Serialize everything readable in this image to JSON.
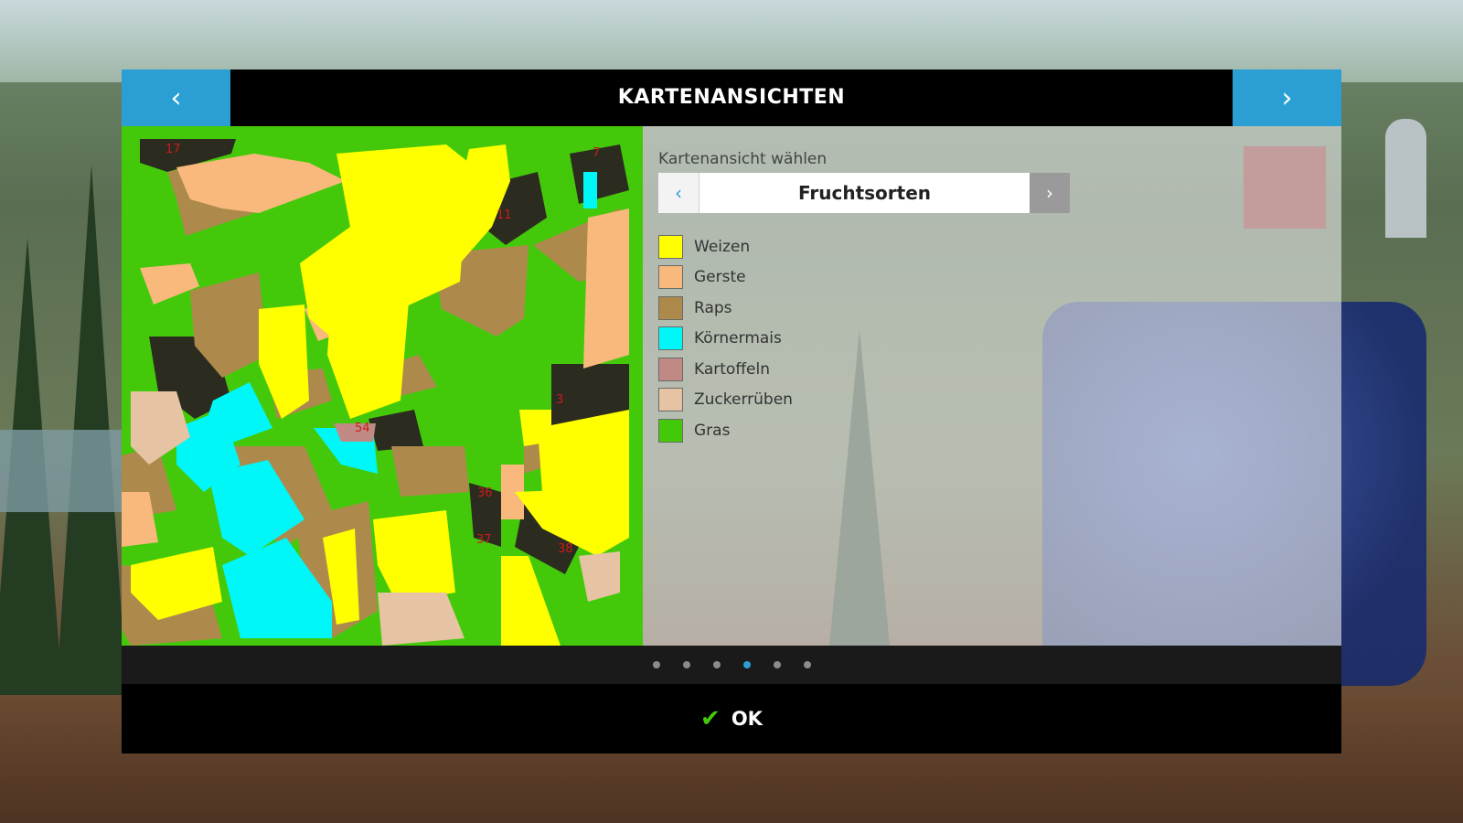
{
  "header": {
    "title": "KARTENANSICHTEN",
    "prev_icon": "‹",
    "next_icon": "›"
  },
  "selector": {
    "label": "Kartenansicht wählen",
    "value": "Fruchtsorten",
    "prev_icon": "‹",
    "next_icon": "›"
  },
  "legend": [
    {
      "label": "Weizen",
      "color": "#ffff00"
    },
    {
      "label": "Gerste",
      "color": "#f9b97c"
    },
    {
      "label": "Raps",
      "color": "#ad8a4c"
    },
    {
      "label": "Körnermais",
      "color": "#00f7f7"
    },
    {
      "label": "Kartoffeln",
      "color": "#c08984"
    },
    {
      "label": "Zuckerrüben",
      "color": "#e6c3a3"
    },
    {
      "label": "Gras",
      "color": "#44c90a"
    }
  ],
  "field_numbers": [
    "17",
    "7",
    "11",
    "3",
    "54",
    "36",
    "37",
    "38"
  ],
  "pagination": {
    "total": 6,
    "active": 3
  },
  "ok_button": {
    "label": "OK",
    "icon": "✔"
  }
}
